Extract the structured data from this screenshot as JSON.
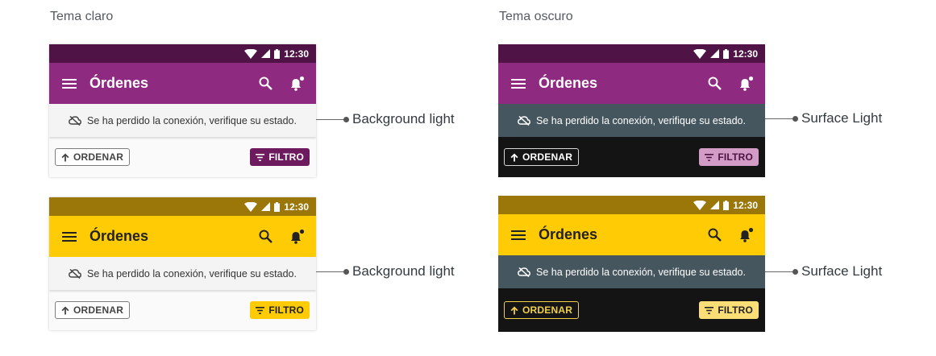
{
  "columns": {
    "light_title": "Tema claro",
    "dark_title": "Tema oscuro"
  },
  "status_bar": {
    "time": "12:30"
  },
  "app_bar": {
    "title": "Órdenes"
  },
  "banner": {
    "text": "Se ha perdido la conexión, verifique su estado."
  },
  "buttons": {
    "sort_label": "ORDENAR",
    "filter_label": "FILTRO"
  },
  "callouts": {
    "light_top": "Background light",
    "light_bottom": "Background light",
    "dark_top": "Surface Light",
    "dark_bottom": "Surface Light"
  },
  "colors": {
    "purple_primary": "#8e2a80",
    "purple_status": "#4f1445",
    "purple_filter": "#6d1a5f",
    "purple_filter_dark": "#d39cc7",
    "yellow_primary": "#ffcb05",
    "yellow_status": "#9a7708",
    "yellow_dark_outline": "#f1cf4a",
    "light_banner": "#f4f4f5",
    "light_surface": "#fafafa",
    "dark_banner": "#46565f",
    "dark_surface": "#141414"
  },
  "icons": [
    "menu-icon",
    "search-icon",
    "notification-bell-icon",
    "cloud-off-icon",
    "arrow-up-icon",
    "filter-icon",
    "wifi-icon",
    "signal-icon",
    "battery-icon"
  ]
}
